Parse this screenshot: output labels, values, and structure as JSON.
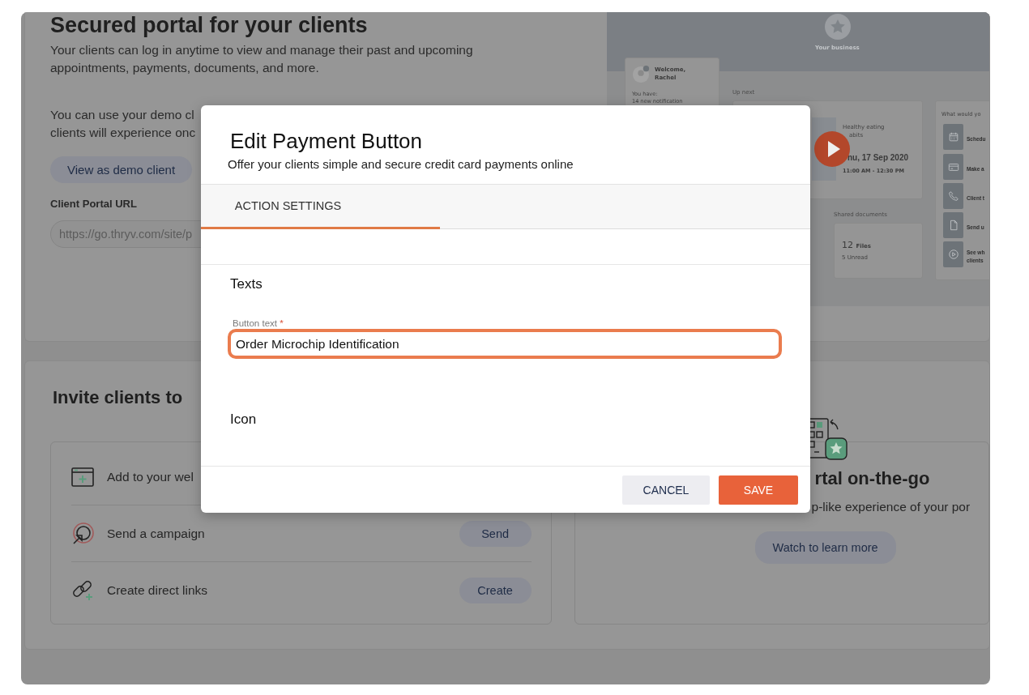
{
  "portal_card": {
    "heading": "Secured portal for your clients",
    "description": "Your clients can log in anytime to view and manage their past and upcoming appointments, payments, documents, and more.",
    "demo_note": [
      "You can use your demo cl",
      "clients will experience onc"
    ],
    "demo_button": "View as demo client",
    "url_label": "Client Portal URL",
    "url_field": {
      "value": "https://go.thryv.com/site/p"
    }
  },
  "preview": {
    "business_name": "Your business",
    "welcome": [
      "Welcome,",
      "Rachel"
    ],
    "notice": [
      "You have:",
      "14 new notification"
    ],
    "up_next_label": "Up next",
    "event": {
      "title": [
        "Healthy eating",
        "abits"
      ],
      "date": "nu, 17 Sep 2020",
      "time": "11:00 AM - 12:30 PM"
    },
    "actions_title": "What would yo",
    "actions": [
      {
        "kind": "calendar",
        "lines": [
          "Schedu"
        ]
      },
      {
        "kind": "card",
        "lines": [
          "Make a"
        ]
      },
      {
        "kind": "phone",
        "lines": [
          "Client t"
        ]
      },
      {
        "kind": "document",
        "lines": [
          "Send u"
        ]
      },
      {
        "kind": "play",
        "lines": [
          "See wh",
          "clients"
        ]
      }
    ],
    "documents_label": "Shared documents",
    "documents": {
      "count": "12",
      "unit": "Files",
      "unread": "5 Unread"
    }
  },
  "invite_card": {
    "heading": "Invite clients to",
    "options": [
      {
        "kind": "website",
        "label": "Add to your wel"
      },
      {
        "kind": "campaign",
        "label": "Send a campaign",
        "button": "Send"
      },
      {
        "kind": "links",
        "label": "Create direct links",
        "button": "Create"
      }
    ]
  },
  "app_card": {
    "heading": "rtal on-the-go",
    "description": "p-like experience of your por",
    "button": "Watch to learn more"
  },
  "modal": {
    "title": "Edit Payment Button",
    "subtitle": "Offer your clients simple and secure credit card payments online",
    "tabs": [
      {
        "label": "ACTION SETTINGS",
        "selected": true
      }
    ],
    "texts_heading": "Texts",
    "button_text_field": {
      "label": "Button text",
      "required_mark": "*",
      "value": "Order Microchip Identification",
      "focused": true
    },
    "icon_heading": "Icon",
    "buttons": [
      {
        "kind": "secondary",
        "label": "CANCEL"
      },
      {
        "kind": "primary",
        "label": "SAVE"
      }
    ]
  }
}
